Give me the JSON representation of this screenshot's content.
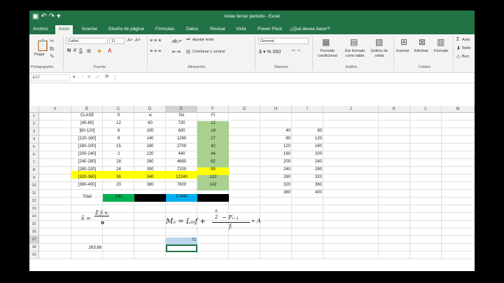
{
  "window": {
    "title": "notas tercer periodo - Excel"
  },
  "tabs": [
    {
      "label": "Archivo"
    },
    {
      "label": "Inicio"
    },
    {
      "label": "Insertar"
    },
    {
      "label": "Diseño de página"
    },
    {
      "label": "Fórmulas"
    },
    {
      "label": "Datos"
    },
    {
      "label": "Revisar"
    },
    {
      "label": "Vista"
    },
    {
      "label": "Power Pivot"
    },
    {
      "label": "¿Qué desea hacer?"
    }
  ],
  "ribbon": {
    "paste_label": "Pegar",
    "clipboard_group": "Portapapeles",
    "font_name": "Calibri",
    "font_size": "11",
    "font_group": "Fuente",
    "wrap_text": "Ajustar texto",
    "merge_center": "Combinar y centrar",
    "alignment_group": "Alineación",
    "number_format": "General",
    "number_group": "Número",
    "cond_format": "Formato condicional",
    "format_table": "Dar formato como tabla",
    "cell_styles": "Estilos de celda",
    "styles_group": "Estilos",
    "insert": "Insertar",
    "delete": "Eliminar",
    "format": "Formato",
    "cells_group": "Celdas",
    "autosum": "Auto",
    "fill": "Relle",
    "clear": "Borr"
  },
  "formula_bar": {
    "name_box": "E17",
    "fx": "fx",
    "content": ""
  },
  "columns": [
    "A",
    "B",
    "C",
    "D",
    "E",
    "F",
    "G",
    "H",
    "I",
    "J",
    "K",
    "L",
    "M"
  ],
  "rows": [
    "1",
    "2",
    "3",
    "4",
    "5",
    "6",
    "7",
    "8",
    "9",
    "10",
    "11",
    "12",
    "13",
    "14",
    "15",
    "16",
    "17",
    "18",
    "19"
  ],
  "table": {
    "headers": [
      "CLASE",
      "fi",
      "xi",
      "fixi",
      "Fi"
    ],
    "rows": [
      [
        "[40-80]",
        "12",
        "60",
        "720",
        "12"
      ],
      [
        "[80-120]",
        "6",
        "100",
        "600",
        "18"
      ],
      [
        "[120-160]",
        "9",
        "140",
        "1260",
        "27"
      ],
      [
        "[160-200]",
        "15",
        "180",
        "2700",
        "42"
      ],
      [
        "[200-240]",
        "2",
        "220",
        "440",
        "44"
      ],
      [
        "[240-280]",
        "18",
        "260",
        "4680",
        "62"
      ],
      [
        "[280-320]",
        "24",
        "300",
        "7200",
        "86"
      ],
      [
        "[320-360]",
        "36",
        "340",
        "12240",
        "122"
      ],
      [
        "[360-400]",
        "20",
        "380",
        "7600",
        "142"
      ]
    ],
    "total_label": "Total",
    "total_fi": "142",
    "total_fixi": "17440"
  },
  "side_table": [
    [
      "40",
      "80"
    ],
    [
      "80",
      "120"
    ],
    [
      "120",
      "160"
    ],
    [
      "160",
      "200"
    ],
    [
      "200",
      "240"
    ],
    [
      "240",
      "280"
    ],
    [
      "280",
      "320"
    ],
    [
      "320",
      "360"
    ],
    [
      "360",
      "400"
    ]
  ],
  "mean_formula": {
    "lhs": "x̄ =",
    "num": "Σ fᵢ xᵢ",
    "den": "n"
  },
  "median_formula": {
    "lhs": "Mₑ = Lᵢₙf +",
    "num_top": "n",
    "num_mid": "2",
    "num_rest": "− Fᵢ₋₁",
    "den": "fᵢ",
    "tail": "∗ A"
  },
  "cell_E16": "71",
  "cell_B17": "263,66",
  "colors": {
    "excel_green": "#217346",
    "yellow": "#ffff00",
    "light_green": "#a9d08e",
    "green": "#00b050",
    "blue": "#00b0f0",
    "light_blue": "#bdd7ee"
  }
}
